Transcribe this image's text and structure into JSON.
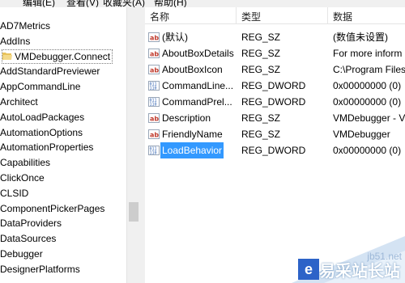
{
  "menu": {
    "items": [
      "编辑(E)",
      "查看(V)",
      "收藏夹(A)",
      "帮助(H)"
    ]
  },
  "tree": {
    "items": [
      "AD7Metrics",
      "AddIns",
      "VMDebugger.Connect",
      "AddStandardPreviewer",
      "AppCommandLine",
      "Architect",
      "AutoLoadPackages",
      "AutomationOptions",
      "AutomationProperties",
      "Capabilities",
      "ClickOnce",
      "CLSID",
      "ComponentPickerPages",
      "DataProviders",
      "DataSources",
      "Debugger",
      "DesignerPlatforms"
    ],
    "selected_index": 2
  },
  "values": {
    "headers": {
      "name": "名称",
      "type": "类型",
      "data": "数据"
    },
    "rows": [
      {
        "icon": "string-value-icon",
        "name": "(默认)",
        "type": "REG_SZ",
        "data": "(数值未设置)"
      },
      {
        "icon": "string-value-icon",
        "name": "AboutBoxDetails",
        "type": "REG_SZ",
        "data": "For more inform"
      },
      {
        "icon": "string-value-icon",
        "name": "AboutBoxIcon",
        "type": "REG_SZ",
        "data": "C:\\Program Files"
      },
      {
        "icon": "dword-value-icon",
        "name": "CommandLine...",
        "type": "REG_DWORD",
        "data": "0x00000000 (0)"
      },
      {
        "icon": "dword-value-icon",
        "name": "CommandPrel...",
        "type": "REG_DWORD",
        "data": "0x00000000 (0)"
      },
      {
        "icon": "string-value-icon",
        "name": "Description",
        "type": "REG_SZ",
        "data": "VMDebugger - V"
      },
      {
        "icon": "string-value-icon",
        "name": "FriendlyName",
        "type": "REG_SZ",
        "data": "VMDebugger"
      },
      {
        "icon": "dword-value-icon",
        "name": "LoadBehavior",
        "type": "REG_DWORD",
        "data": "0x00000000 (0)"
      }
    ],
    "selected_index": 7
  },
  "watermark": {
    "brand": "易采站长站",
    "url": "jb51.net"
  },
  "colors": {
    "selection": "#3399ff",
    "folder": "#e8c25a",
    "string_icon": "#c0392b",
    "dword_icon": "#2a5db0"
  }
}
